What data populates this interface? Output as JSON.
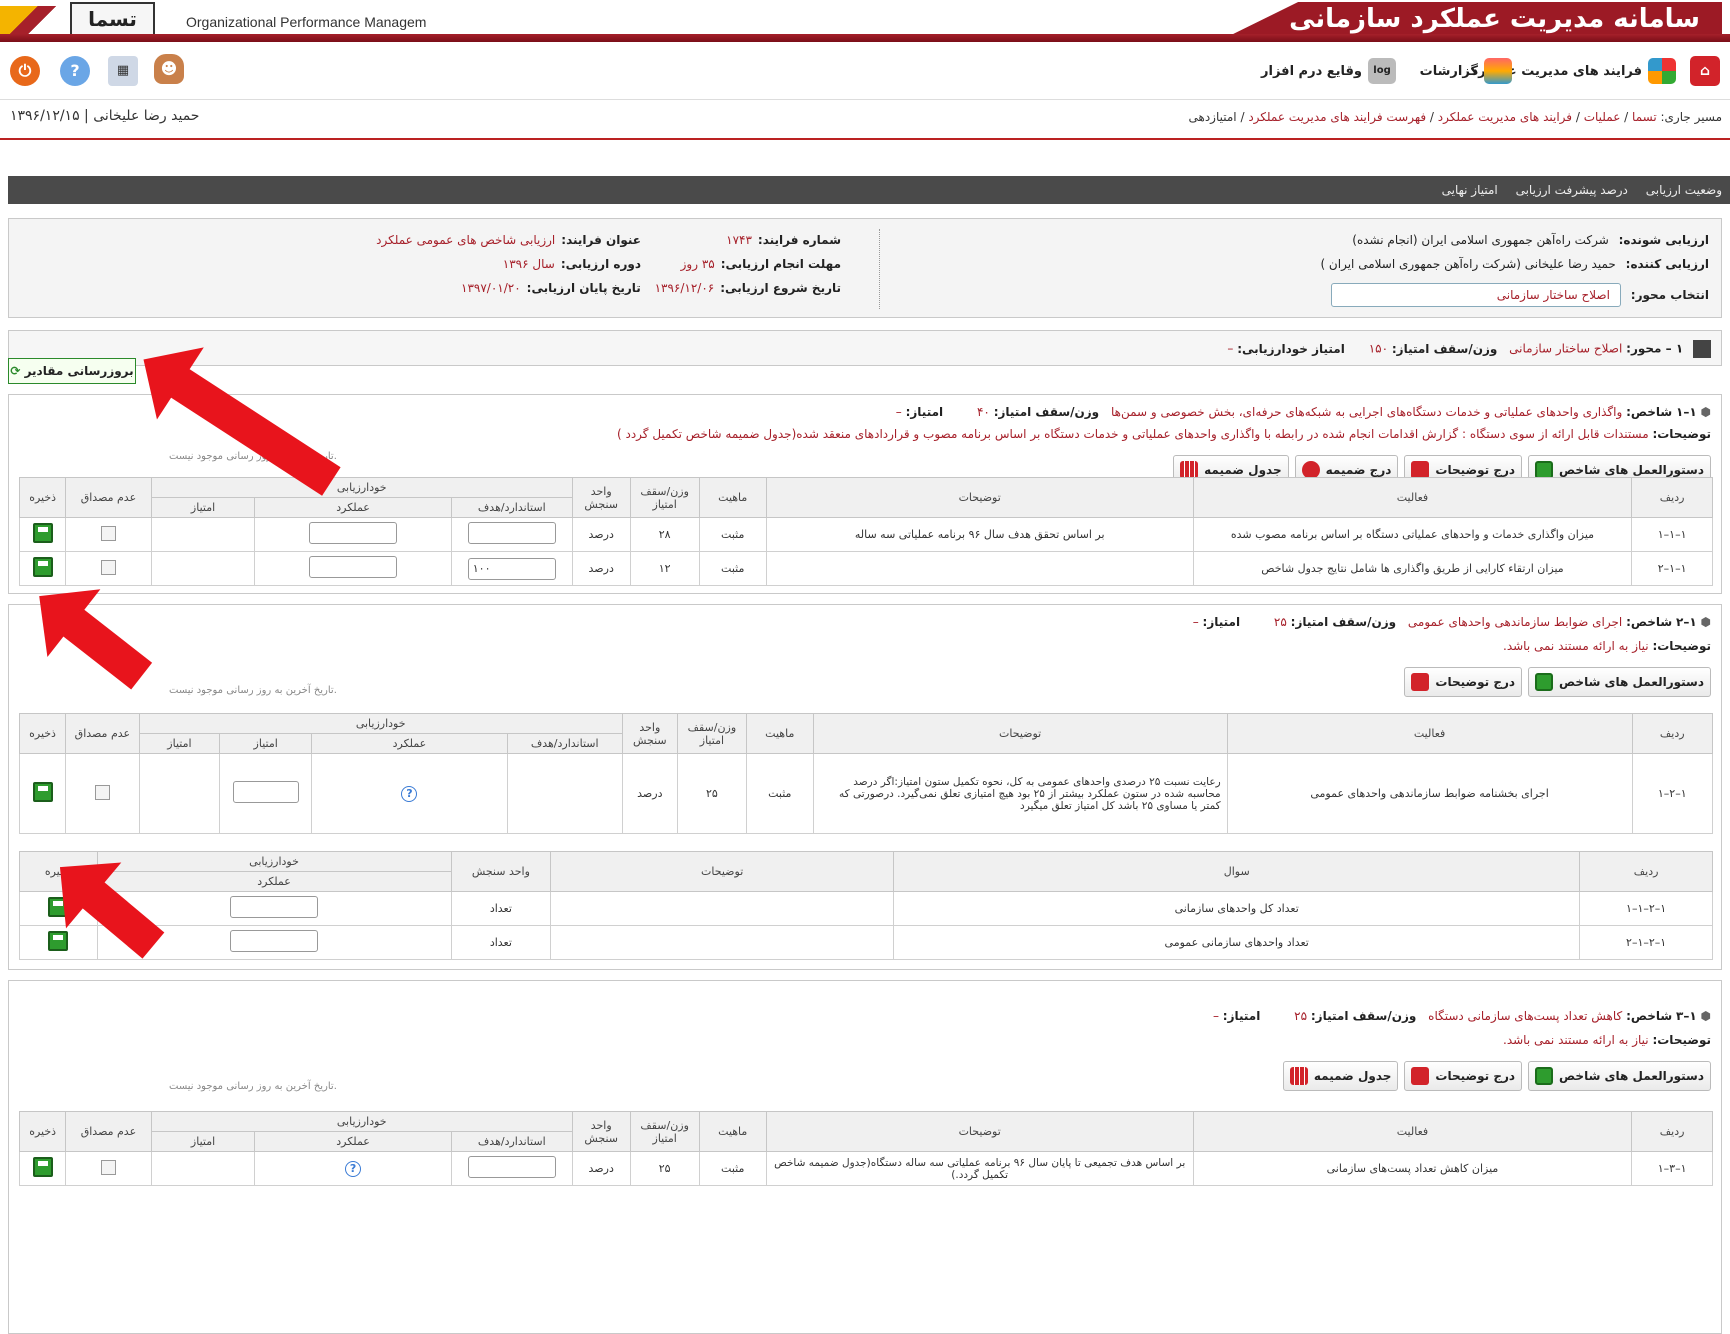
{
  "header": {
    "app_title": "سامانه مدیریت عملکرد سازمانی",
    "english_title": "Organizational Performance Managem",
    "logo_text": "تسما",
    "brand_color": "#a6202a"
  },
  "toolbar": {
    "menu": [
      "فرایند های مدیریت عملکرد",
      "گزارشات",
      "وقایع درم افزار"
    ]
  },
  "breadcrumb": {
    "prefix": "مسیر جاری:",
    "items": [
      "تسما",
      "عملیات",
      "فرایند های مدیریت عملکرد",
      "فهرست فرایند های مدیریت عملکرد",
      "امتیازدهی"
    ],
    "separator": " / "
  },
  "user": {
    "name": "حمید رضا علیخانی",
    "date": "۱۳۹۶/۱۲/۱۵"
  },
  "tabs": [
    "وضعیت ارزیابی",
    "درصد پیشرفت ارزیابی",
    "امتیاز نهایی"
  ],
  "info": {
    "evaluatee_label": "ارزیابی شونده:",
    "evaluatee": "شرکت راه‌آهن جمهوری اسلامی ایران (انجام نشده)",
    "evaluator_label": "ارزیابی کننده:",
    "evaluator": "حمید رضا علیخانی (شرکت راه‌آهن جمهوری اسلامی ایران )",
    "axis_select_label": "انتخاب محور:",
    "axis_select_value": "اصلاح ساختار سازمانی",
    "process_no_label": "شماره فرایند:",
    "process_no": "۱۷۴۳",
    "deadline_label": "مهلت انجام ارزیابی:",
    "deadline": "۳۵ روز",
    "start_label": "تاریخ شروع ارزیابی:",
    "start": "۱۳۹۶/۱۲/۰۶",
    "end_label": "تاریخ پایان ارزیابی:",
    "end": "۱۳۹۷/۰۱/۲۰",
    "title_label": "عنوان فرایند:",
    "title": "ارزیابی شاخص های عمومی عملکرد",
    "period_label": "دوره ارزیابی:",
    "period": "سال ۱۳۹۶"
  },
  "axis": {
    "label": "۱ – محور:",
    "name": "اصلاح ساختار سازمانی",
    "weight_label": "وزن/سقف امتیاز:",
    "weight": "۱۵۰",
    "self_label": "امتیاز خودارزیابی:",
    "self": "–"
  },
  "update_button": "بروزرسانی مقادیر",
  "common": {
    "last_update_note": "تاریخ آخرین به روز رسانی موجود نیست.",
    "btn_instructions": "دستورالعمل های شاخص",
    "btn_add_desc": "درج توضیحات",
    "btn_add_attach": "درج ضمیمه",
    "btn_attach_table": "جدول ضمیمه",
    "col_row": "ردیف",
    "col_activity": "فعالیت",
    "col_desc": "توضیحات",
    "col_nature": "ماهیت",
    "col_weight": "وزن/سقف امتیاز",
    "col_unit": "واحد سنجش",
    "col_self": "خودارزیابی",
    "col_standard": "استاندارد/هدف",
    "col_perf": "عملکرد",
    "col_score": "امتیاز",
    "col_noconf": "عدم مصداق",
    "col_save": "ذخیره",
    "col_question": "سوال",
    "desc_label": "توضیحات:",
    "score_label": "امتیاز:",
    "weight_label": "وزن/سقف امتیاز:",
    "index_label": "شاخص:"
  },
  "sections": [
    {
      "num": "۱–۱",
      "title": "واگذاری واحدهای عملیاتی و خدمات دستگاه‌های اجرایی به شبکه‌های حرفه‌ای، بخش خصوصی و سمن‌ها",
      "weight": "۴۰",
      "score": "–",
      "desc": "مستندات قابل ارائه از سوی دستگاه : گزارش اقدامات انجام شده در رابطه با واگذاری واحدهای عملیاتی و خدمات دستگاه بر اساس برنامه مصوب و قراردادهای منعقد شده(جدول ضمیمه شاخص تکمیل گردد )",
      "rows": [
        {
          "id": "۱–۱–۱",
          "activity": "میزان واگذاری خدمات و واحدهای عملیاتی دستگاه بر اساس برنامه مصوب شده",
          "desc": "بر اساس تحقق هدف سال ۹۶ برنامه عملیاتی سه ساله",
          "nature": "مثبت",
          "weight": "۲۸",
          "unit": "درصد",
          "standard": ""
        },
        {
          "id": "۱–۱–۲",
          "activity": "میزان ارتقاء کارایی از طریق واگذاری ها شامل نتایج جدول شاخص",
          "desc": "",
          "nature": "مثبت",
          "weight": "۱۲",
          "unit": "درصد",
          "standard": "۱۰۰"
        }
      ]
    },
    {
      "num": "۱–۲",
      "title": "اجرای ضوابط سازماندهی واحدهای عمومی",
      "weight": "۲۵",
      "score": "–",
      "desc": "نیاز به ارائه مستند نمی باشد.",
      "rows": [
        {
          "id": "۱–۲–۱",
          "activity": "اجرای بخشنامه ضوابط سازماندهی واحدهای عمومی",
          "desc": "رعایت نسبت ۲۵ درصدی واحدهای عمومی به کل، نحوه تکمیل ستون امتیاز:اگر درصد محاسبه شده در ستون عملکرد بیشتر از ۲۵ بود هیچ امتیازی تعلق نمی‌گیرد. درصورتی که کمتر یا مساوی ۲۵ باشد کل امتیاز تعلق میگیرد",
          "nature": "مثبت",
          "weight": "۲۵",
          "unit": "درصد"
        }
      ],
      "questions": [
        {
          "id": "۱–۲–۱–۱",
          "question": "تعداد کل واحدهای سازمانی",
          "unit": "تعداد"
        },
        {
          "id": "۱–۲–۱–۲",
          "question": "تعداد واحدهای سازمانی عمومی",
          "unit": "تعداد"
        }
      ]
    },
    {
      "num": "۱–۳",
      "title": "کاهش تعداد پست‌های سازمانی دستگاه",
      "weight": "۲۵",
      "score": "–",
      "desc": "نیاز به ارائه مستند نمی باشد.",
      "rows": [
        {
          "id": "۱–۳–۱",
          "activity": "میزان کاهش تعداد پست‌های سازمانی",
          "desc": "بر اساس هدف تجمیعی تا پایان سال ۹۶ برنامه عملیاتی سه ساله دستگاه(جدول ضمیمه شاخص تکمیل گردد.)",
          "nature": "مثبت",
          "weight": "۲۵",
          "unit": "درصد"
        }
      ]
    }
  ]
}
